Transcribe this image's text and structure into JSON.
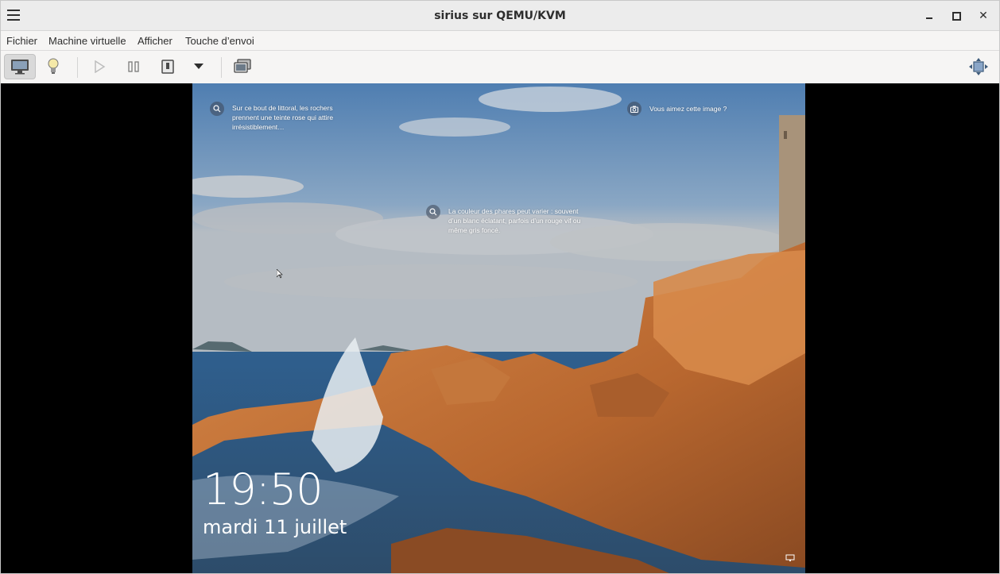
{
  "window": {
    "title": "sirius sur QEMU/KVM"
  },
  "menubar": {
    "items": [
      "Fichier",
      "Machine virtuelle",
      "Afficher",
      "Touche d’envoi"
    ]
  },
  "toolbar": {
    "icons": [
      "console-icon",
      "details-lightbulb-icon",
      "run-icon",
      "pause-icon",
      "shutdown-icon",
      "shutdown-menu-arrow-icon",
      "snapshot-icon",
      "fullscreen-icon"
    ]
  },
  "lockscreen": {
    "hint_top_left": "Sur ce bout de littoral, les rochers prennent une teinte rose qui attire irrésistiblement…",
    "hint_top_right": "Vous aimez cette image ?",
    "hint_center": "La couleur des phares peut varier : souvent d’un blanc éclatant, parfois d’un rouge vif ou même gris foncé.",
    "time": "19:50",
    "date": "mardi 11 juillet"
  },
  "colors": {
    "sky": "#7e9ec2",
    "sea": "#3a6487",
    "rock": "#c8743a"
  }
}
